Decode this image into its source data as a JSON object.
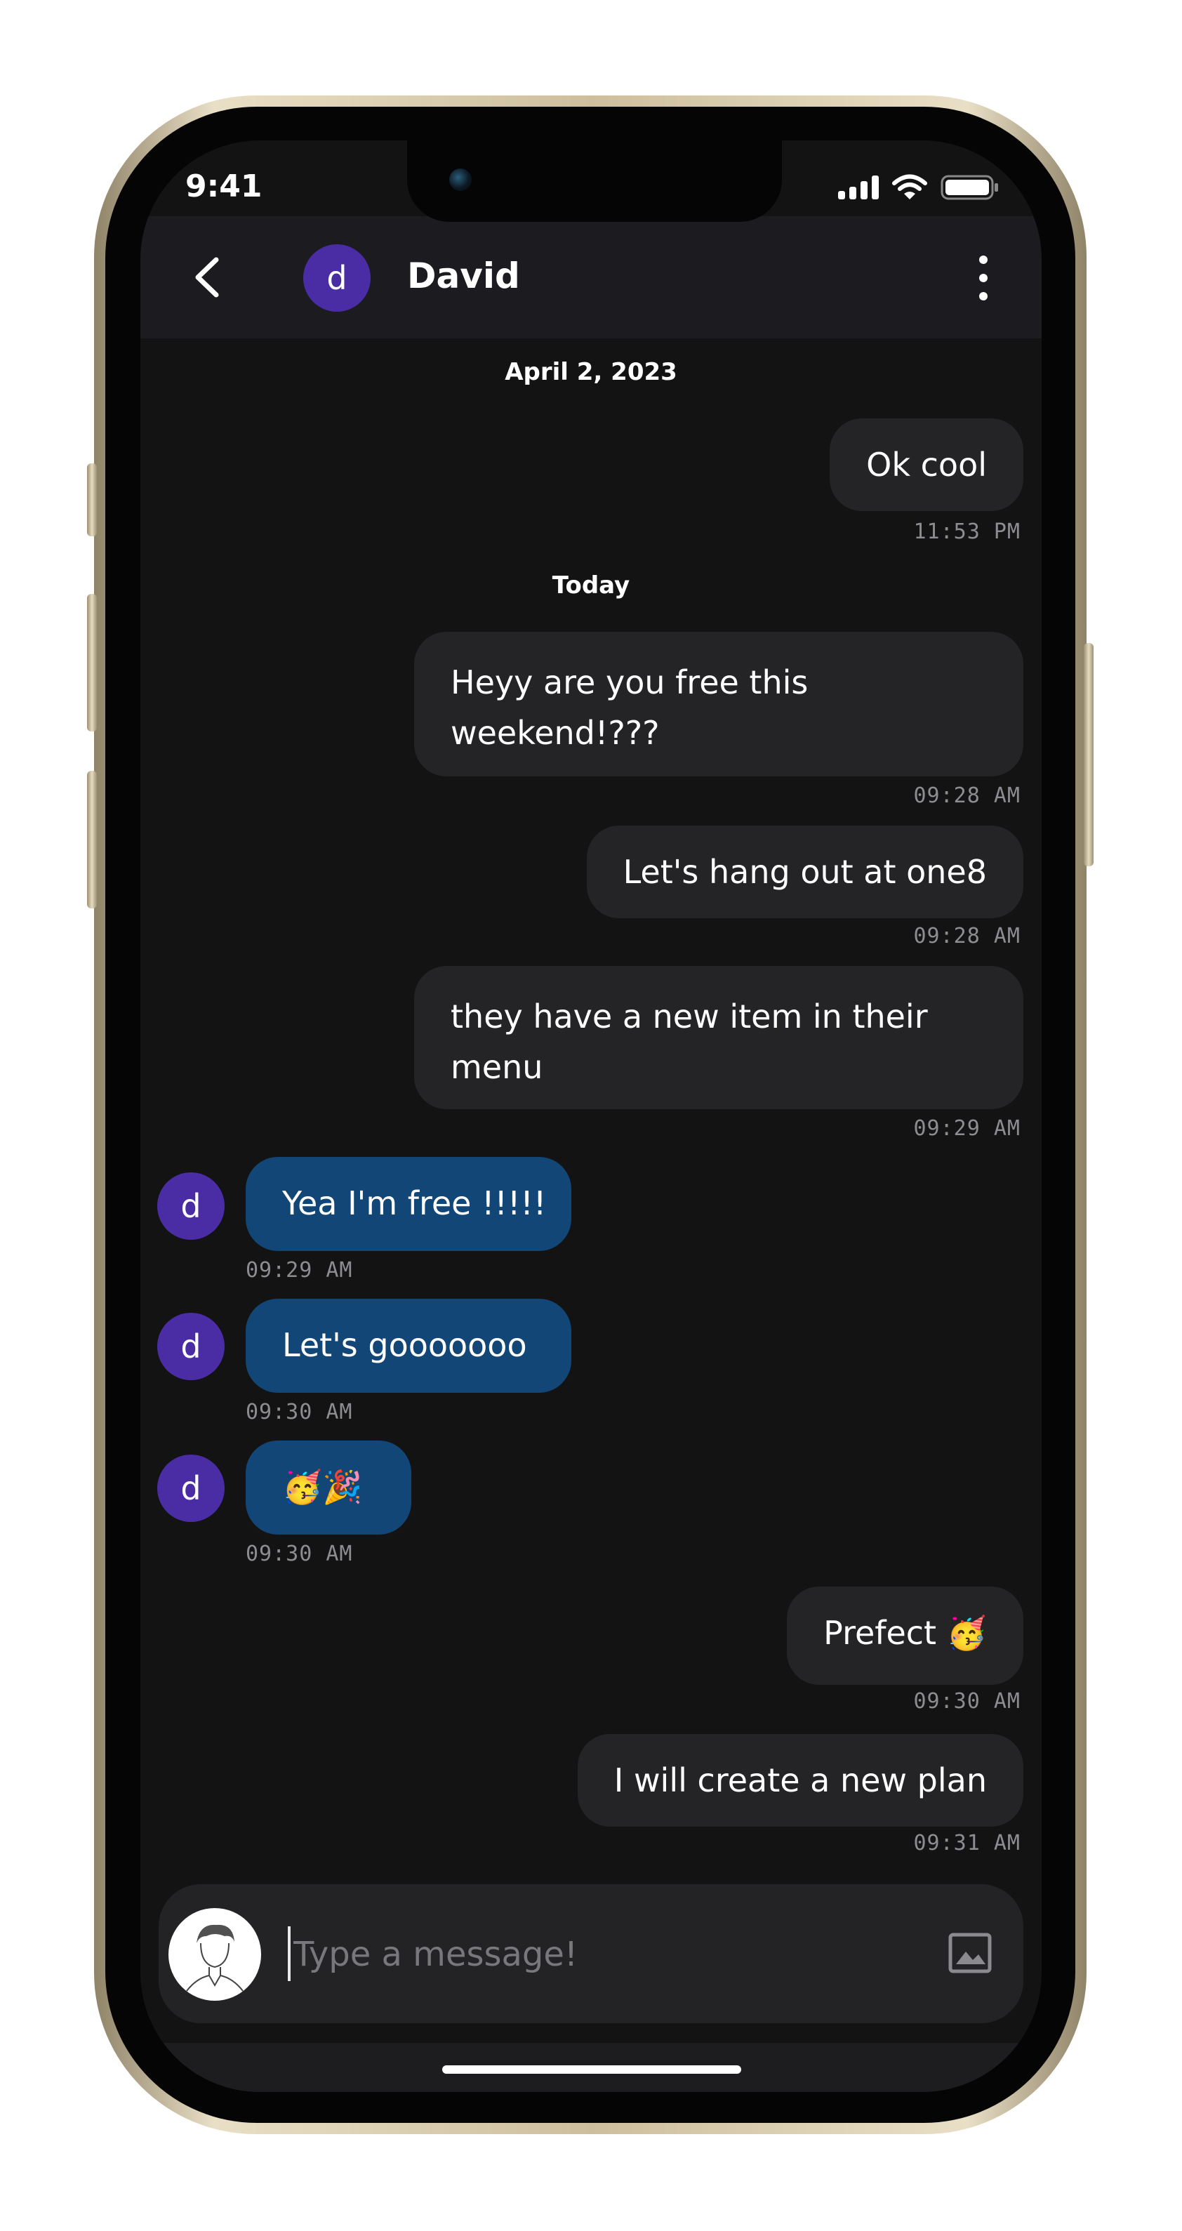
{
  "status_bar": {
    "time": "9:41"
  },
  "header": {
    "contact_initial": "d",
    "contact_name": "David"
  },
  "conversation": {
    "sections": [
      {
        "date": "April 2, 2023",
        "messages": [
          {
            "direction": "outgoing",
            "text": "Ok cool",
            "time": "11:53 PM"
          }
        ]
      },
      {
        "date": "Today",
        "messages": [
          {
            "direction": "outgoing",
            "text": "Heyy are you free this weekend!???",
            "time": "09:28 AM"
          },
          {
            "direction": "outgoing",
            "text": "Let's hang out at one8",
            "time": "09:28 AM"
          },
          {
            "direction": "outgoing",
            "text": "they have a new item in their menu",
            "time": "09:29 AM"
          },
          {
            "direction": "incoming",
            "sender_initial": "d",
            "text": "Yea I'm free !!!!!",
            "time": "09:29 AM"
          },
          {
            "direction": "incoming",
            "sender_initial": "d",
            "text": "Let's gooooooo",
            "time": "09:30 AM"
          },
          {
            "direction": "incoming",
            "sender_initial": "d",
            "text": "🥳🎉",
            "time": "09:30 AM"
          },
          {
            "direction": "outgoing",
            "text": "Prefect 🥳",
            "time": "09:30 AM"
          },
          {
            "direction": "outgoing",
            "text": "I will create a new plan",
            "time": "09:31 AM"
          }
        ]
      }
    ]
  },
  "composer": {
    "placeholder": "Type a message!",
    "value": ""
  },
  "colors": {
    "background": "#131314",
    "header": "#1b1b20",
    "outgoing_bubble": "#242427",
    "incoming_bubble": "#124677",
    "avatar": "#4a2da4",
    "timestamp": "#8c8c91"
  },
  "icons": [
    "back-chevron-icon",
    "more-vertical-icon",
    "signal-icon",
    "wifi-icon",
    "battery-icon",
    "image-icon"
  ]
}
